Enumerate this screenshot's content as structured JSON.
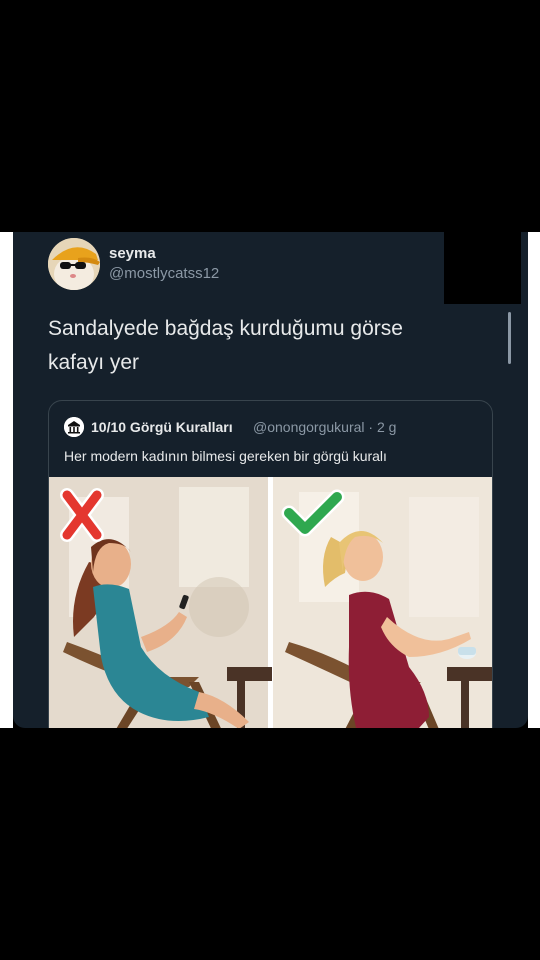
{
  "tweet": {
    "name": "seyma",
    "handle": "@mostlycatss12",
    "text_line1": "Sandalyede bağdaş kurduğumu görse",
    "text_line2": "kafayı yer"
  },
  "quote": {
    "name": "10/10 Görgü Kuralları",
    "handle": "@onongorgukural · 2 g",
    "text": "Her modern kadının bilmesi gereken bir görgü kuralı"
  },
  "colors": {
    "card_bg": "#15202b",
    "text": "#e7e9ea",
    "muted": "#8b98a5",
    "wrong": "#e4372f",
    "right": "#2fa84f"
  },
  "icons": [
    "avatar-cat-with-cap",
    "temple-icon",
    "cross-mark-icon",
    "check-mark-icon"
  ]
}
